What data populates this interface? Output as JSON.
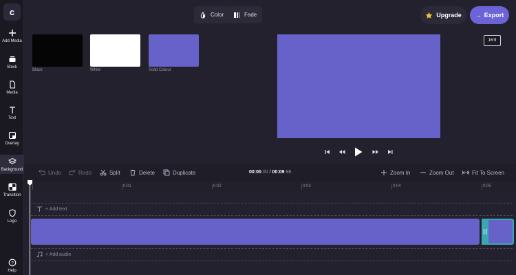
{
  "app": {
    "logo_letter": "c"
  },
  "sidebar": {
    "items": [
      {
        "label": "Add Media",
        "icon": "plus-icon"
      },
      {
        "label": "Stock",
        "icon": "stock-icon"
      },
      {
        "label": "Media",
        "icon": "file-icon"
      },
      {
        "label": "Text",
        "icon": "text-icon"
      },
      {
        "label": "Overlay",
        "icon": "overlay-icon"
      },
      {
        "label": "Background",
        "icon": "layers-icon",
        "active": true
      },
      {
        "label": "Transition",
        "icon": "transition-icon"
      },
      {
        "label": "Logo",
        "icon": "shield-icon"
      },
      {
        "label": "Help",
        "icon": "help-icon"
      }
    ]
  },
  "toolbar": {
    "color_label": "Color",
    "fade_label": "Fade",
    "upgrade_label": "Upgrade",
    "export_label": "Export"
  },
  "backgrounds": [
    {
      "label": "Black",
      "color": "#050505"
    },
    {
      "label": "White",
      "color": "#ffffff"
    },
    {
      "label": "Solid Colour",
      "color": "#6762c9"
    }
  ],
  "preview": {
    "aspect_ratio": "16:9",
    "color": "#6762c9"
  },
  "timeline_toolbar": {
    "undo_label": "Undo",
    "redo_label": "Redo",
    "split_label": "Split",
    "delete_label": "Delete",
    "duplicate_label": "Duplicate",
    "zoom_in_label": "Zoom In",
    "zoom_out_label": "Zoom Out",
    "fit_label": "Fit To Screen",
    "time_current_main": "00:00",
    "time_current_frac": ".00",
    "time_sep": " / ",
    "time_total_main": "00:09",
    "time_total_frac": ".98"
  },
  "ruler": {
    "ticks": [
      "0",
      "0:01",
      "0:02",
      "0:03",
      "0:04",
      "0:05"
    ]
  },
  "tracks": {
    "add_text_label": "+ Add text",
    "add_audio_label": "+ Add audio"
  },
  "colors": {
    "accent": "#6b63d6",
    "clip": "#6762c9",
    "selected_clip_border": "#3aa8b3"
  }
}
